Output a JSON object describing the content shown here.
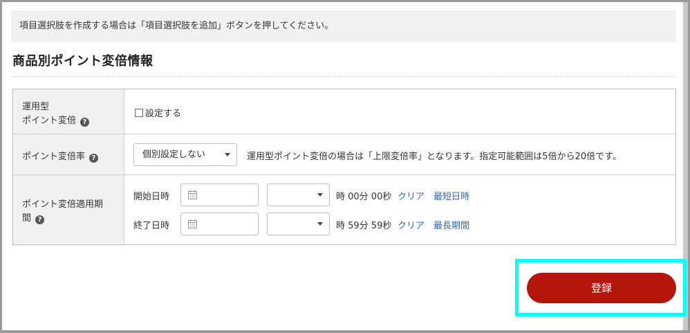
{
  "info_message": "項目選択肢を作成する場合は「項目選択肢を追加」ボタンを押してください。",
  "section_title": "商品別ポイント変倍情報",
  "rows": {
    "operation_type": {
      "label_line1": "運用型",
      "label_line2": "ポイント変倍",
      "help": "?",
      "checkbox_label": "設定する",
      "checked": false
    },
    "point_rate": {
      "label": "ポイント変倍率",
      "help": "?",
      "select_value": "個別設定しない",
      "note": "運用型ポイント変倍の場合は「上限変倍率」となります。指定可能範囲は5倍から20倍です。"
    },
    "period": {
      "label_line1": "ポイント変倍適用期",
      "label_line2": "間",
      "help": "?",
      "start": {
        "label": "開始日時",
        "date_value": "",
        "hour_value": "",
        "suffix": "時 00分 00秒",
        "clear": "クリア",
        "shortcut": "最短日時"
      },
      "end": {
        "label": "終了日時",
        "date_value": "",
        "hour_value": "",
        "suffix": "時 59分 59秒",
        "clear": "クリア",
        "shortcut": "最長期間"
      }
    }
  },
  "submit_label": "登録",
  "colors": {
    "submit_bg": "#b5160b",
    "link": "#3366b3",
    "highlight": "#00ffff"
  },
  "icons": {
    "help": "question-circle-icon",
    "calendar": "calendar-icon",
    "caret": "chevron-down-icon"
  }
}
